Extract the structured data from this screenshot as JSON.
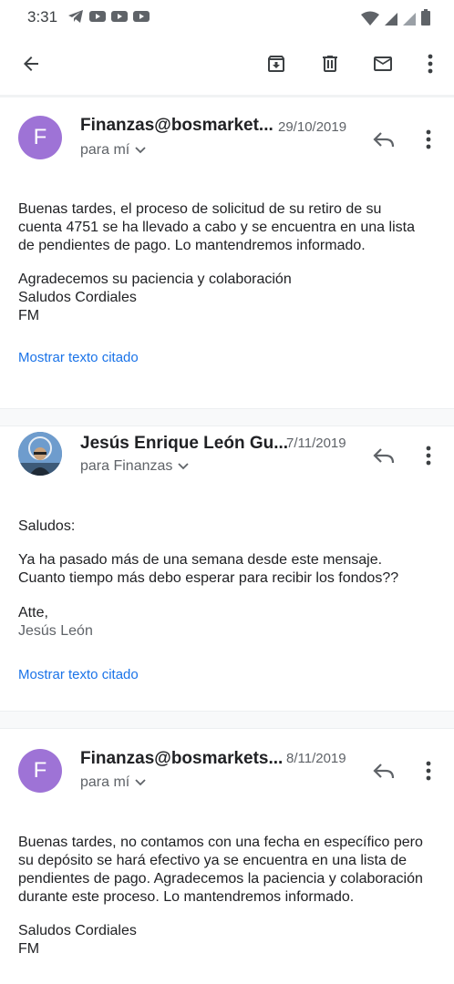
{
  "status_bar": {
    "time": "3:31",
    "icons": [
      "telegram-icon",
      "youtube-icon",
      "youtube-icon",
      "youtube-icon"
    ],
    "right_icons": [
      "wifi-icon",
      "signal-icon",
      "signal-icon",
      "battery-icon"
    ]
  },
  "toolbar": {
    "icons": [
      "back-arrow-icon",
      "archive-icon",
      "delete-icon",
      "mark-unread-icon",
      "more-vert-icon"
    ]
  },
  "messages": [
    {
      "avatar_letter": "F",
      "sender": "Finanzas@bosmarket...",
      "date": "29/10/2019",
      "recipient": "para mí",
      "body": [
        "Buenas tardes, el proceso de solicitud de su retiro de su",
        "cuenta 4751 se ha llevado a cabo y se encuentra en una lista",
        "de pendientes de pago. Lo mantendremos informado.",
        "",
        "Agradecemos su paciencia y colaboración",
        "Saludos Cordiales",
        "FM"
      ],
      "quoted_link": "Mostrar texto citado"
    },
    {
      "avatar_letter": "",
      "sender": "Jesús Enrique León Gu...",
      "date": "7/11/2019",
      "recipient": "para Finanzas",
      "body": [
        "Saludos:",
        "",
        "Ya ha pasado más de una semana desde este mensaje.",
        "Cuanto tiempo más debo esperar para recibir los fondos??",
        "",
        "Atte,"
      ],
      "signature": "Jesús León",
      "quoted_link": "Mostrar texto citado"
    },
    {
      "avatar_letter": "F",
      "sender": "Finanzas@bosmarkets...",
      "date": "8/11/2019",
      "recipient": "para mí",
      "body": [
        "Buenas tardes, no contamos con una fecha en específico pero",
        "su depósito se hará efectivo ya se encuentra en una lista de",
        "pendientes de pago. Agradecemos la paciencia y colaboración",
        "durante este proceso. Lo mantendremos informado.",
        "",
        "Saludos Cordiales",
        "FM"
      ]
    }
  ],
  "colors": {
    "avatar": "#9e73d6",
    "link": "#1a73e8",
    "secondary_text": "#5f6368"
  }
}
